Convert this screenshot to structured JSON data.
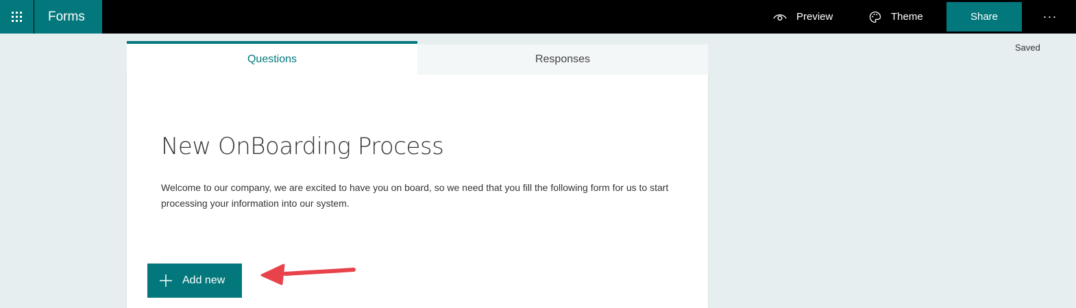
{
  "app": {
    "name": "Forms",
    "accent_color": "#03787c",
    "topbar_color": "#000000"
  },
  "toolbar": {
    "waffle_icon": "app-launcher-icon",
    "preview_label": "Preview",
    "preview_icon": "eye-icon",
    "theme_label": "Theme",
    "theme_icon": "palette-icon",
    "share_label": "Share",
    "more_label": "···"
  },
  "status": {
    "saved_text": "Saved"
  },
  "tabs": [
    {
      "label": "Questions",
      "active": true
    },
    {
      "label": "Responses",
      "active": false
    }
  ],
  "form": {
    "title": "New OnBoarding Process",
    "description": "Welcome to our company, we are excited to have you on board, so we need that you fill the following form for us to start processing your information into our system.",
    "add_new_label": "Add new",
    "add_new_icon": "plus-icon"
  },
  "annotation": {
    "arrow_color": "#e8424a",
    "arrow_icon": "annotation-arrow-icon"
  }
}
